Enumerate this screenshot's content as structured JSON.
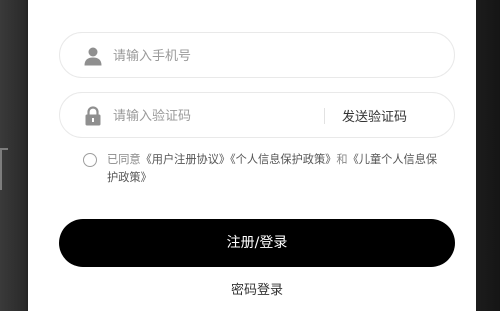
{
  "login": {
    "phone_placeholder": "请输入手机号",
    "code_placeholder": "请输入验证码",
    "send_code_label": "发送验证码",
    "agreement": {
      "prefix": "已同意",
      "user_agreement": "《用户注册协议》",
      "privacy_policy": "《个人信息保护政策》",
      "and": "和",
      "child_policy": "《儿童个人信息保护政策》"
    },
    "submit_label": "注册/登录",
    "alt_login_label": "密码登录"
  },
  "icons": {
    "phone_field": "user-icon",
    "code_field": "lock-icon"
  },
  "colors": {
    "primary_button": "#000000",
    "panel": "#ffffff",
    "placeholder": "#9a9a9a",
    "field_border": "#e9e9e9"
  }
}
